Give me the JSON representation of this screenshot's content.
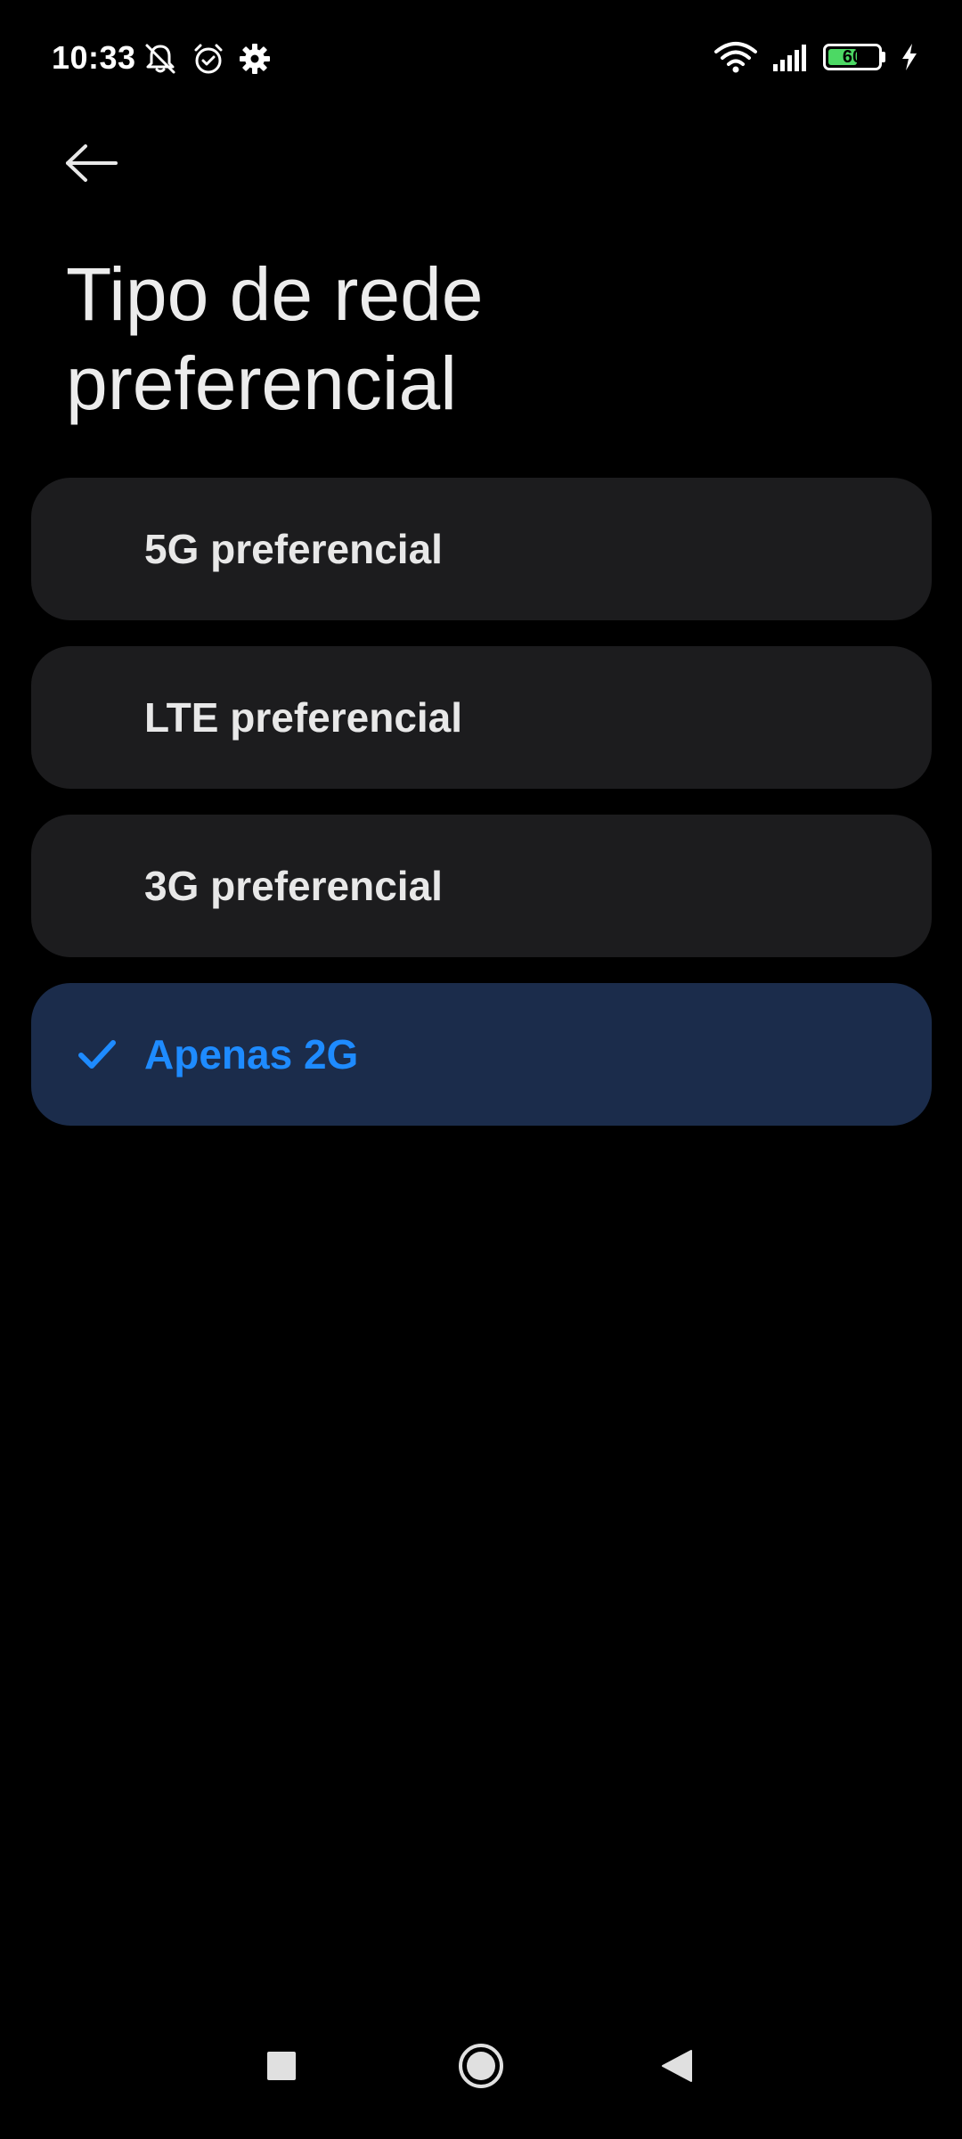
{
  "status_bar": {
    "time": "10:33",
    "left_icons": [
      "notifications-off-icon",
      "alarm-icon",
      "settings-gear-icon"
    ],
    "right_icons": [
      "wifi-icon",
      "cellular-signal-icon",
      "battery-icon",
      "charging-bolt-icon"
    ],
    "battery_level": "60",
    "battery_fill_fraction": 0.6,
    "battery_color": "#4cd964"
  },
  "header": {
    "back_icon": "arrow-left-icon",
    "title": "Tipo de rede preferencial"
  },
  "options": [
    {
      "label": "5G preferencial",
      "selected": false
    },
    {
      "label": "LTE preferencial",
      "selected": false
    },
    {
      "label": "3G preferencial",
      "selected": false
    },
    {
      "label": "Apenas 2G",
      "selected": true
    }
  ],
  "colors": {
    "background": "#000000",
    "option_background": "#1c1c1e",
    "selected_background": "#1b2c4b",
    "accent": "#1e8bff"
  },
  "nav_bar": {
    "icons": [
      "recents-square-icon",
      "home-circle-icon",
      "back-triangle-icon"
    ]
  }
}
